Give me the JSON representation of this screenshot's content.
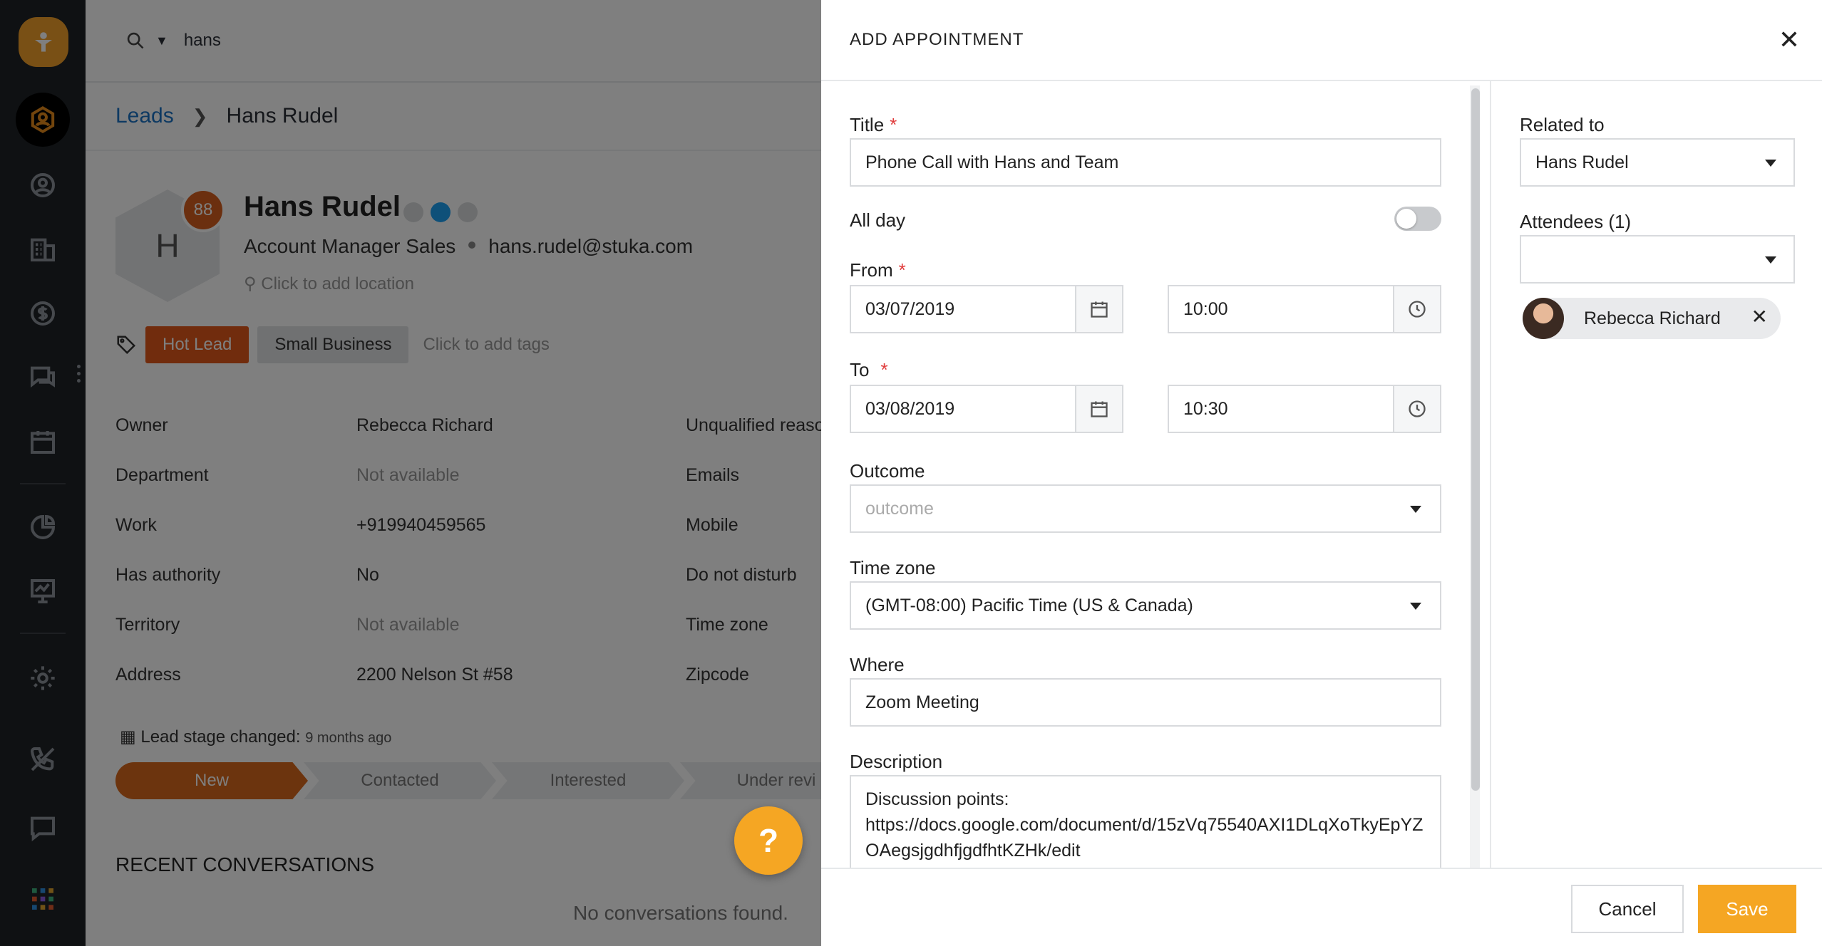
{
  "search": {
    "query": "hans"
  },
  "breadcrumb": {
    "parent": "Leads",
    "current": "Hans Rudel"
  },
  "lead": {
    "name": "Hans Rudel",
    "initial": "H",
    "score": "88",
    "role": "Account Manager Sales",
    "email": "hans.rudel@stuka.com",
    "location_placeholder": "Click to add location",
    "tags": [
      "Hot Lead",
      "Small Business"
    ],
    "tag_placeholder": "Click to add tags"
  },
  "details": [
    {
      "label": "Owner",
      "value": "Rebecca Richard",
      "muted": false,
      "label2": "Unqualified reaso"
    },
    {
      "label": "Department",
      "value": "Not available",
      "muted": true,
      "label2": "Emails"
    },
    {
      "label": "Work",
      "value": "+919940459565",
      "muted": false,
      "label2": "Mobile"
    },
    {
      "label": "Has authority",
      "value": "No",
      "muted": false,
      "label2": "Do not disturb"
    },
    {
      "label": "Territory",
      "value": "Not available",
      "muted": true,
      "label2": "Time zone"
    },
    {
      "label": "Address",
      "value": "2200 Nelson St #58",
      "muted": false,
      "label2": "Zipcode"
    }
  ],
  "stage": {
    "heading": "Lead stage changed:",
    "ago": "9 months ago",
    "steps": [
      "New",
      "Contacted",
      "Interested",
      "Under revi"
    ]
  },
  "recent": {
    "heading": "RECENT CONVERSATIONS",
    "empty": "No conversations found."
  },
  "help": {
    "label": "?"
  },
  "modal": {
    "title": "ADD APPOINTMENT",
    "close": "✕",
    "title_label": "Title",
    "title_value": "Phone Call with Hans and Team",
    "allday_label": "All day",
    "from_label": "From",
    "from_date": "03/07/2019",
    "from_time": "10:00",
    "to_label": "To",
    "to_date": "03/08/2019",
    "to_time": "10:30",
    "outcome_label": "Outcome",
    "outcome_placeholder": "outcome",
    "timezone_label": "Time zone",
    "timezone_value": "(GMT-08:00) Pacific Time (US & Canada)",
    "where_label": "Where",
    "where_value": "Zoom Meeting",
    "description_label": "Description",
    "description_value": "Discussion points:\nhttps://docs.google.com/document/d/15zVq75540AXI1DLqXoTkyEpYZOAegsjgdhfjgdfhtKZHk/edit",
    "required_mark": "*",
    "related_label": "Related to",
    "related_value": "Hans Rudel",
    "attendees_label": "Attendees (1)",
    "attendee_name": "Rebecca Richard",
    "cancel": "Cancel",
    "save": "Save"
  },
  "colors": {
    "accent": "#f5a623",
    "hot_tag": "#e3581a",
    "stage_active": "#d9681d",
    "sidebar": "#1f2327"
  }
}
